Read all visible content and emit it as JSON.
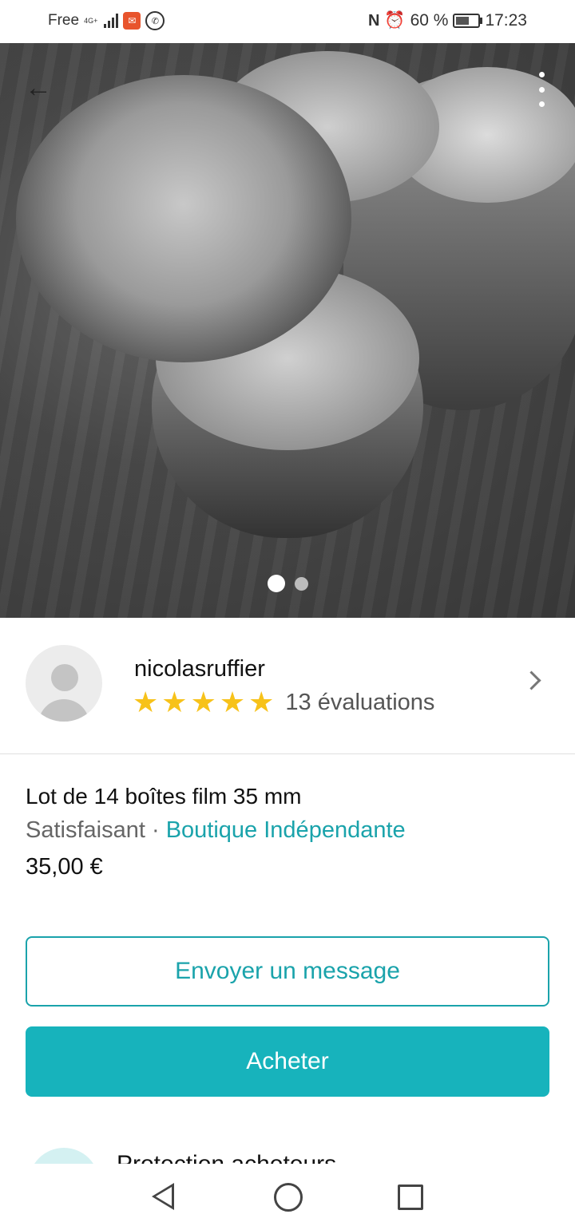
{
  "status_bar": {
    "carrier": "Free",
    "network": "4G+",
    "battery": "60 %",
    "battery_level": 0.6,
    "time": "17:23"
  },
  "listing_photo": {
    "current_page": 1,
    "total_pages": 2,
    "back_icon": "arrow-left-icon",
    "more_icon": "more-vertical-icon"
  },
  "seller": {
    "username": "nicolasruffier",
    "stars": 5,
    "star_glyph": "★",
    "reviews_label": "13 évaluations"
  },
  "item": {
    "title": "Lot de 14 boîtes film 35 mm",
    "condition": "Satisfaisant",
    "separator": " · ",
    "category": "Boutique Indépendante",
    "price": "35,00 €"
  },
  "actions": {
    "message_label": "Envoyer un message",
    "buy_label": "Acheter"
  },
  "protection": {
    "label": "Protection acheteurs"
  },
  "colors": {
    "accent": "#17b3bc",
    "star": "#f7c21a"
  }
}
